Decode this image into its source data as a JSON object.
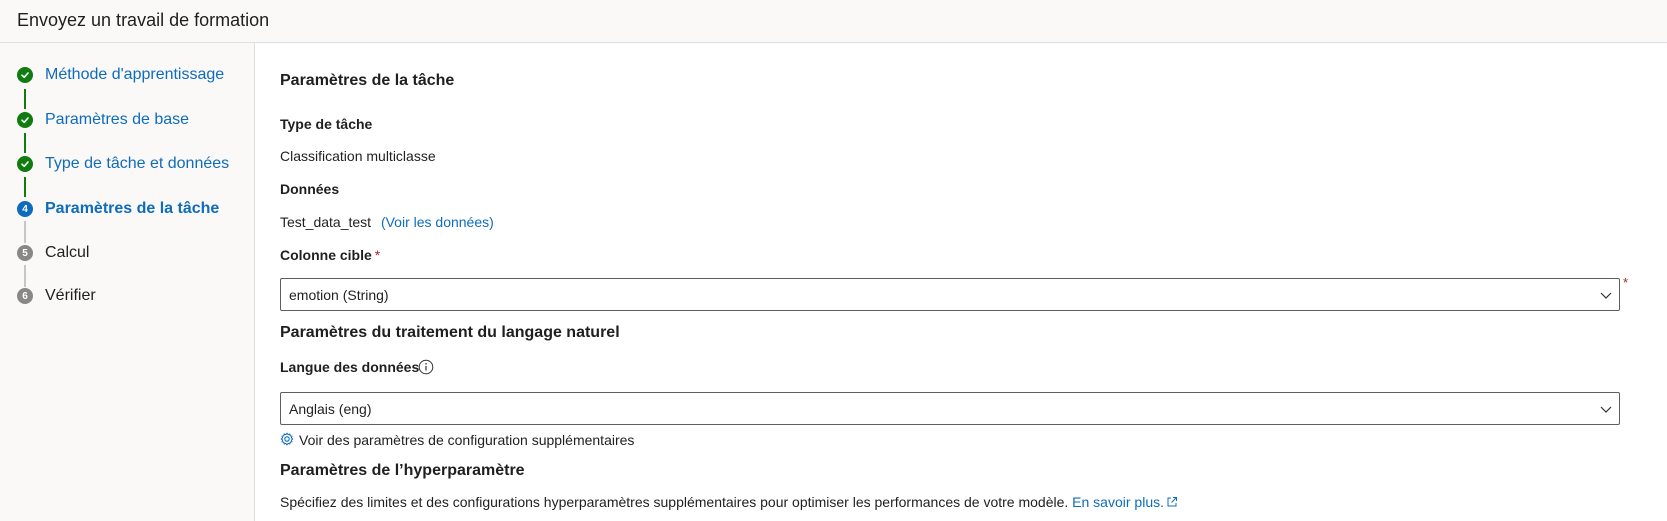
{
  "header": {
    "title": "Envoyez un travail de formation"
  },
  "steps": [
    {
      "number": "1",
      "label": "Méthode d'apprentissage",
      "status": "done"
    },
    {
      "number": "2",
      "label": "Paramètres de base",
      "status": "done"
    },
    {
      "number": "3",
      "label": "Type de tâche et données",
      "status": "done"
    },
    {
      "number": "4",
      "label": "Paramètres de la tâche",
      "status": "active"
    },
    {
      "number": "5",
      "label": "Calcul",
      "status": "pending"
    },
    {
      "number": "6",
      "label": "Vérifier",
      "status": "pending"
    }
  ],
  "main": {
    "section_title": "Paramètres de la tâche",
    "task_type_label": "Type de tâche",
    "task_type_value": "Classification multiclasse",
    "data_label": "Données",
    "data_value": "Test_data_test",
    "view_data_link": "(Voir les données)",
    "target_column_label": "Colonne cible",
    "required_mark": "*",
    "target_column_value": "emotion (String)",
    "nlp_section_title": "Paramètres du traitement du langage naturel",
    "data_language_label": "Langue des données",
    "data_language_value": "Anglais (eng)",
    "extra_config_link": "Voir des paramètres de configuration supplémentaires",
    "hyperparam_title": "Paramètres de l’hyperparamètre",
    "hyperparam_desc": "Spécifiez des limites et des configurations hyperparamètres supplémentaires pour optimiser les performances de votre modèle.",
    "learn_more_link": "En savoir plus."
  },
  "colors": {
    "accent": "#0f6cbd",
    "success": "#107c10",
    "required": "#a4262c",
    "pending": "#8a8886"
  },
  "icons": [
    "checkmark-icon",
    "info-icon",
    "gear-icon",
    "chevron-down-icon",
    "external-link-icon"
  ]
}
